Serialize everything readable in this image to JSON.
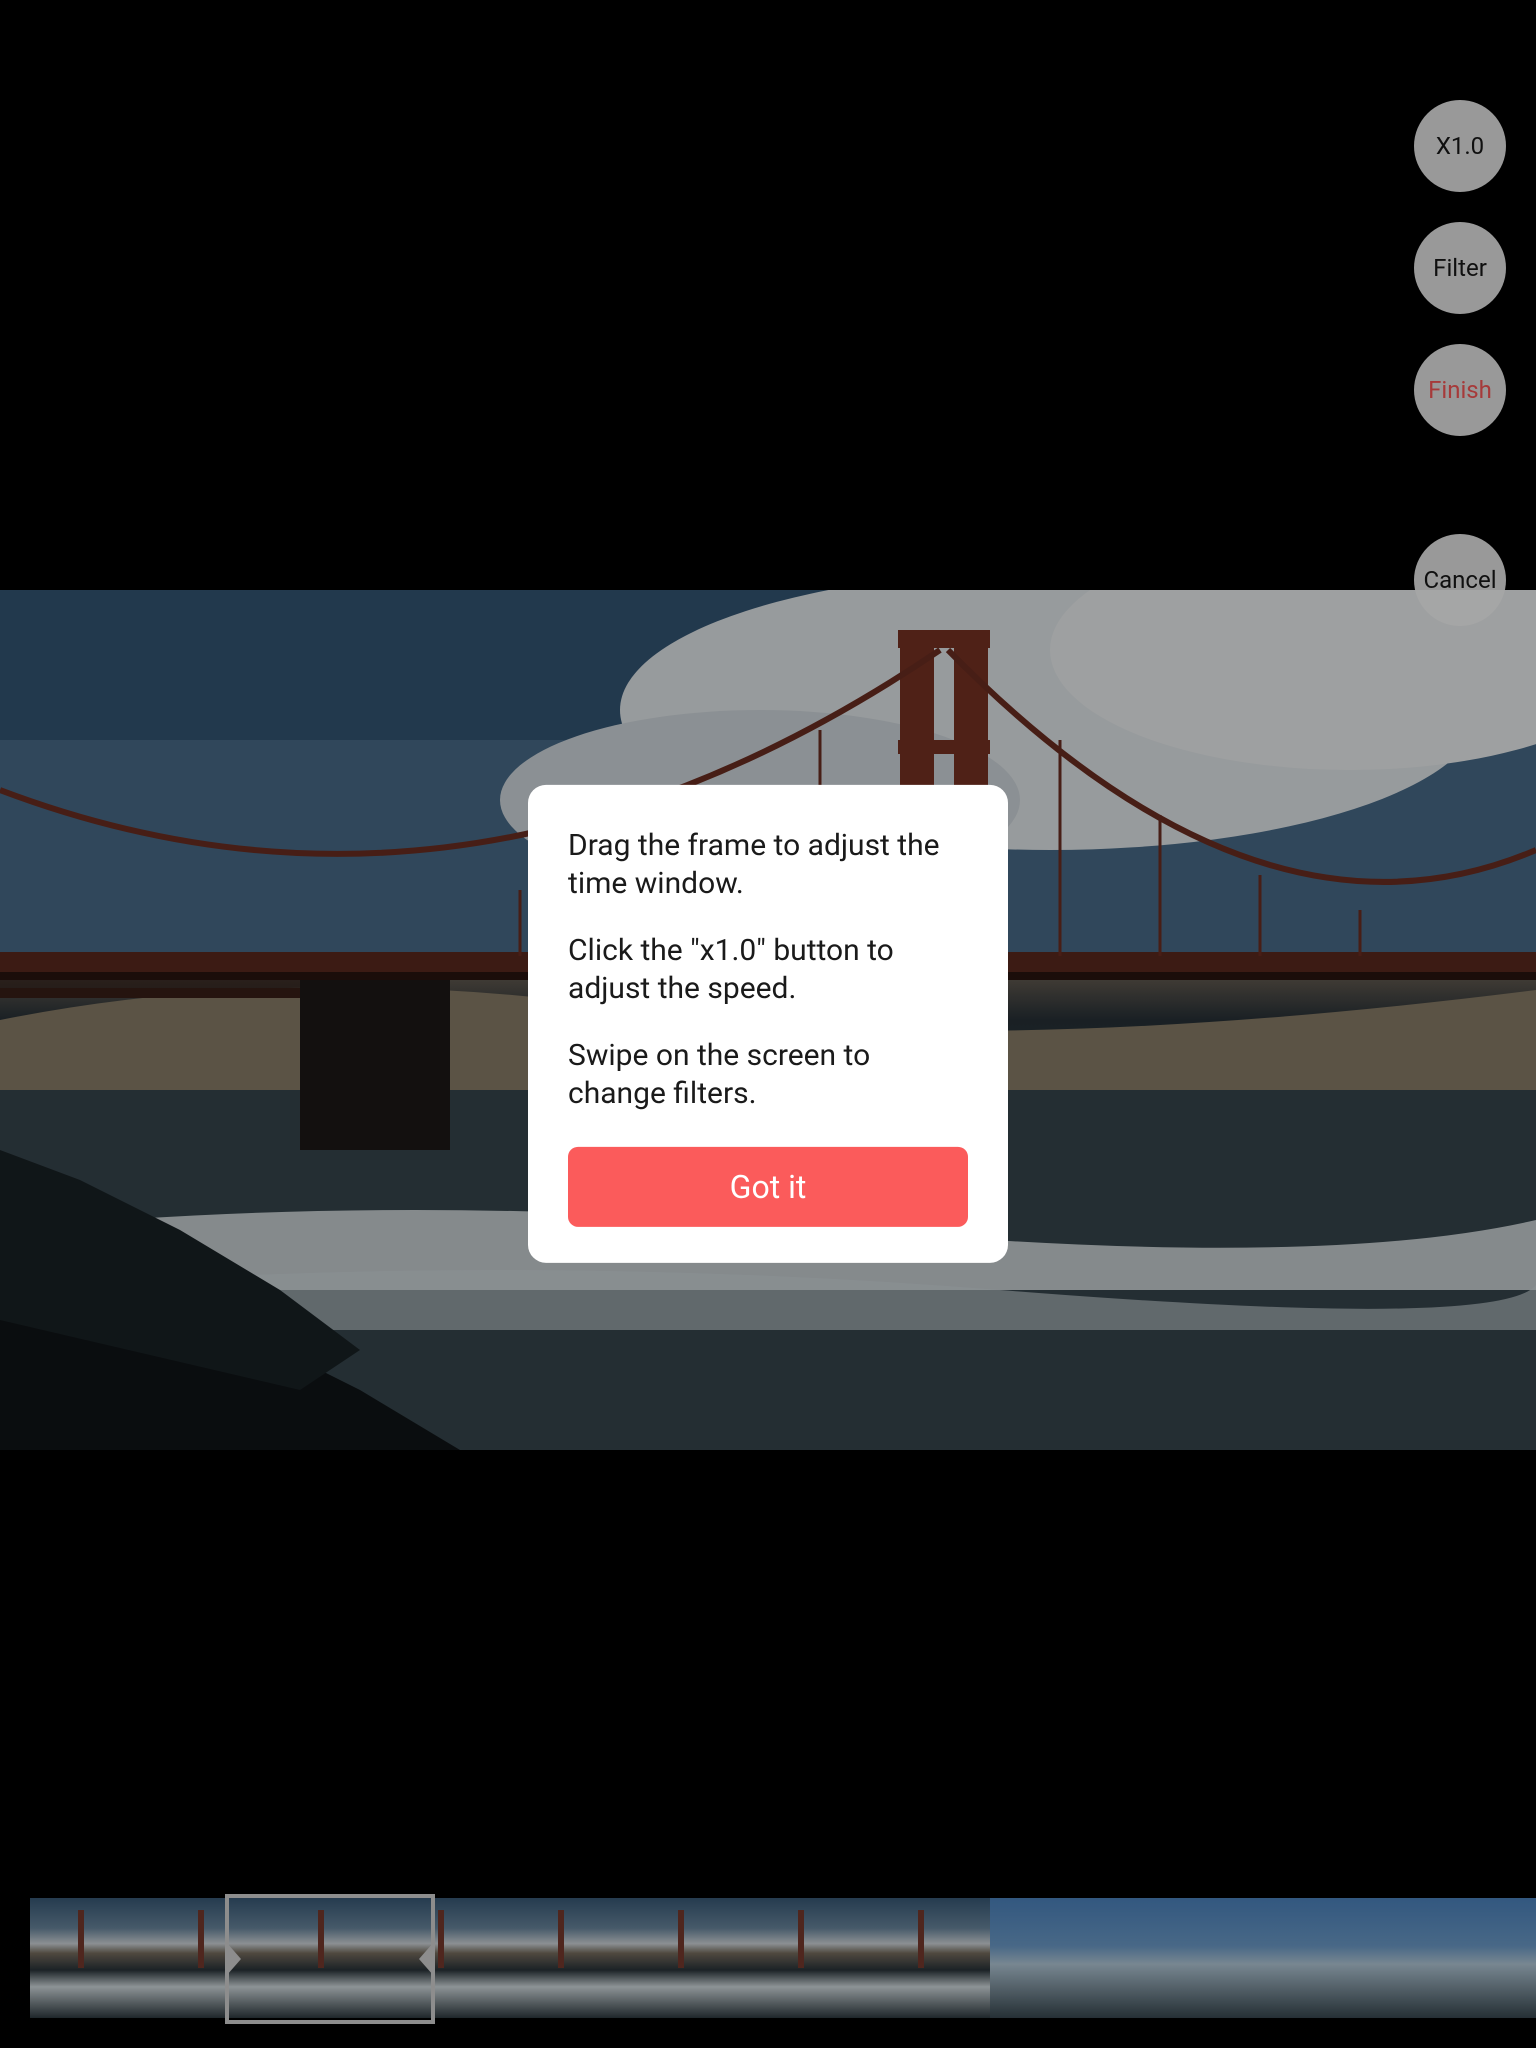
{
  "controls": {
    "speed_label": "X1.0",
    "filter_label": "Filter",
    "finish_label": "Finish",
    "cancel_label": "Cancel"
  },
  "tooltip": {
    "line1": "Drag the frame to adjust the time window.",
    "line2": "Click the \"x1.0\" button to adjust the speed.",
    "line3": "Swipe on the screen to change filters.",
    "button": "Got it"
  },
  "colors": {
    "accent": "#fb5b5b"
  }
}
